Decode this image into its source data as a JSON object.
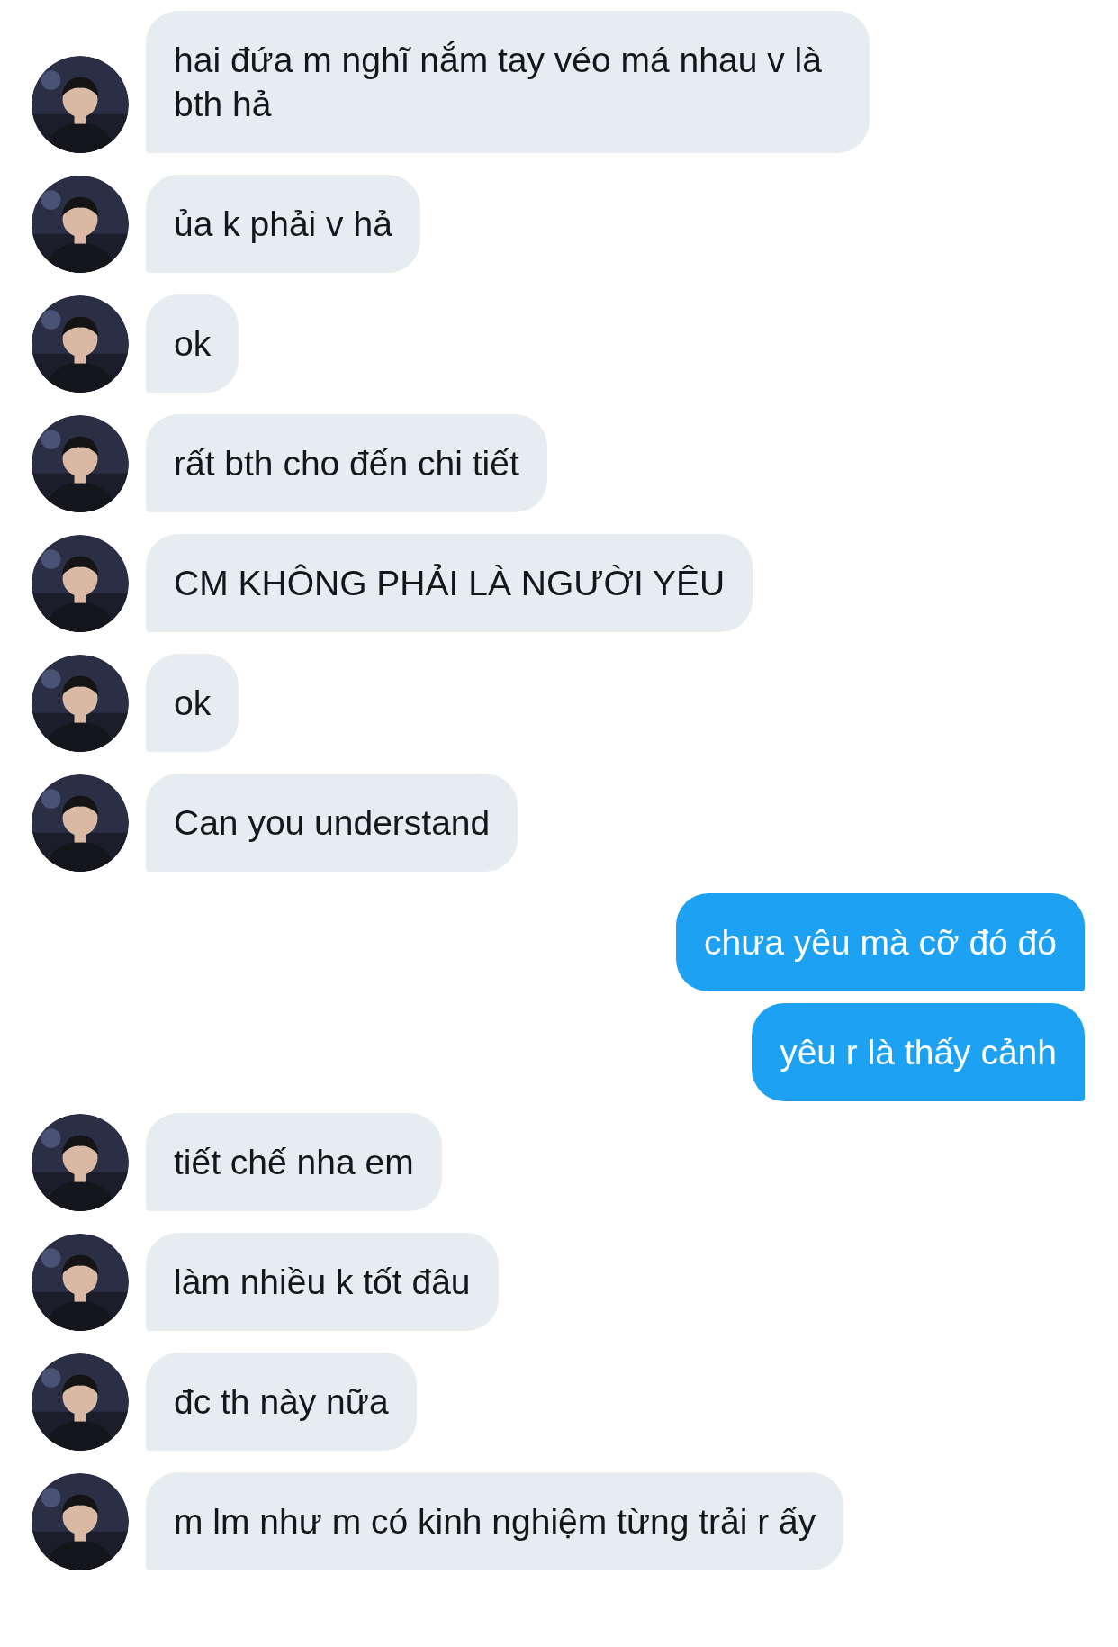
{
  "messages": [
    {
      "kind": "incoming",
      "text": "hai đứa m nghĩ nắm tay véo má nhau v là bth hả"
    },
    {
      "kind": "incoming",
      "text": "ủa k phải v hả"
    },
    {
      "kind": "incoming",
      "text": "ok"
    },
    {
      "kind": "incoming",
      "text": "rất bth cho đến chi tiết"
    },
    {
      "kind": "incoming",
      "text": "CM KHÔNG PHẢI LÀ NGƯỜI YÊU"
    },
    {
      "kind": "incoming",
      "text": "ok"
    },
    {
      "kind": "incoming",
      "text": "Can you understand"
    },
    {
      "kind": "outgoing",
      "text": "chưa yêu mà cỡ đó đó"
    },
    {
      "kind": "outgoing",
      "text": "yêu r là thấy cảnh"
    },
    {
      "kind": "incoming",
      "text": "tiết chế nha em"
    },
    {
      "kind": "incoming",
      "text": "làm nhiều k tốt đâu"
    },
    {
      "kind": "incoming",
      "text": "đc th này nữa"
    },
    {
      "kind": "incoming",
      "text": "m lm như m có kinh nghiệm từng trải r ấy"
    }
  ]
}
